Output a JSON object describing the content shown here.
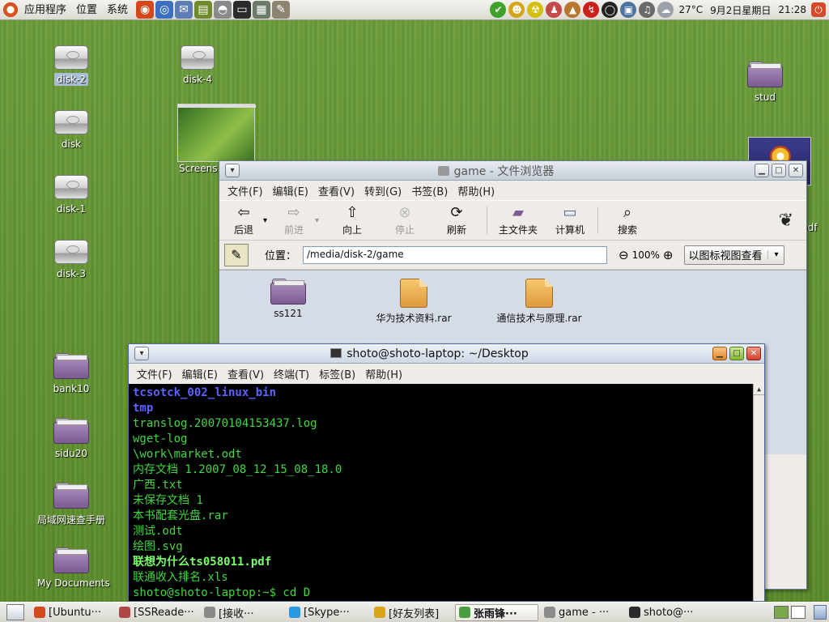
{
  "top_panel": {
    "menus": [
      "应用程序",
      "位置",
      "系统"
    ],
    "launchers": [
      {
        "icon": "firefox-icon",
        "color": "#d4481b",
        "glyph": "◉"
      },
      {
        "icon": "web-browser-icon",
        "color": "#3b6fc1",
        "glyph": "◎"
      },
      {
        "icon": "email-icon",
        "color": "#5e7db5",
        "glyph": "✉"
      },
      {
        "icon": "books-icon",
        "color": "#6f8a2a",
        "glyph": "▤"
      },
      {
        "icon": "disk-icon",
        "color": "#8a8a8a",
        "glyph": "◓"
      },
      {
        "icon": "terminal-icon",
        "color": "#2b2b2b",
        "glyph": "▭"
      },
      {
        "icon": "calculator-icon",
        "color": "#6c7a6a",
        "glyph": "▦"
      },
      {
        "icon": "text-editor-icon",
        "color": "#8d8572",
        "glyph": "✎"
      }
    ],
    "tray_icons": [
      {
        "icon": "update-check-icon",
        "color": "#3fa32b",
        "glyph": "✔"
      },
      {
        "icon": "user-icon",
        "color": "#d8a41c",
        "glyph": "☻"
      },
      {
        "icon": "radiation-icon",
        "color": "#d5bf0e",
        "glyph": "☢"
      },
      {
        "icon": "chat-icon",
        "color": "#c44a4a",
        "glyph": "♟"
      },
      {
        "icon": "tux-icon",
        "color": "#b8762e",
        "glyph": "▲"
      },
      {
        "icon": "flash-icon",
        "color": "#c9221c",
        "glyph": "↯"
      },
      {
        "icon": "eyes-icon",
        "color": "#222222",
        "glyph": "◯"
      },
      {
        "icon": "network-icon",
        "color": "#4d73a3",
        "glyph": "▣"
      },
      {
        "icon": "volume-icon",
        "color": "#6a6a6a",
        "glyph": "♫"
      },
      {
        "icon": "weather-icon",
        "color": "#9ca0a8",
        "glyph": "☁"
      }
    ],
    "temperature": "27°C",
    "date": "9月2日星期日",
    "time": "21:28",
    "shutdown_icon": "power-icon"
  },
  "desktop_icons": [
    {
      "label": "disk-2",
      "type": "drive",
      "selected": true
    },
    {
      "label": "disk-4",
      "type": "drive"
    },
    {
      "label": "disk",
      "type": "drive"
    },
    {
      "label": "disk-1",
      "type": "drive"
    },
    {
      "label": "disk-3",
      "type": "drive"
    },
    {
      "label": "bank10",
      "type": "folder"
    },
    {
      "label": "sidu20",
      "type": "folder"
    },
    {
      "label": "局域网速查手册",
      "type": "folder"
    },
    {
      "label": "My Documents",
      "type": "folder"
    },
    {
      "label": "stud",
      "type": "folder"
    },
    {
      "label": "Screens",
      "type": "thumbnail"
    },
    {
      "label": "pdf",
      "type": "thumbnail"
    }
  ],
  "file_browser": {
    "title": "game - 文件浏览器",
    "menus": [
      "文件(F)",
      "编辑(E)",
      "查看(V)",
      "转到(G)",
      "书签(B)",
      "帮助(H)"
    ],
    "toolbar": {
      "back": "后退",
      "forward": "前进",
      "up": "向上",
      "stop": "停止",
      "reload": "刷新",
      "home": "主文件夹",
      "computer": "计算机",
      "search": "搜索"
    },
    "location_label": "位置：",
    "location_value": "/media/disk-2/game",
    "zoom": "100%",
    "view_mode": "以图标视图查看",
    "files": [
      {
        "name": "ss121",
        "type": "folder"
      },
      {
        "name": "华为技术资料.rar",
        "type": "archive"
      },
      {
        "name": "通信技术与原理.rar",
        "type": "archive"
      }
    ]
  },
  "terminal": {
    "title": "shoto@shoto-laptop: ~/Desktop",
    "menus": [
      "文件(F)",
      "编辑(E)",
      "查看(V)",
      "终端(T)",
      "标签(B)",
      "帮助(H)"
    ],
    "lines": [
      {
        "text": "tcsotck_002_linux_bin",
        "style": "blue"
      },
      {
        "text": "tmp",
        "style": "blue"
      },
      {
        "text": "translog.20070104153437.log",
        "style": "normal"
      },
      {
        "text": "wget-log",
        "style": "normal"
      },
      {
        "text": "\\work\\market.odt",
        "style": "normal"
      },
      {
        "text": "内存文档 1.2007_08_12_15_08_18.0",
        "style": "normal"
      },
      {
        "text": "广西.txt",
        "style": "normal"
      },
      {
        "text": "未保存文档 1",
        "style": "normal"
      },
      {
        "text": "本书配套光盘.rar",
        "style": "normal"
      },
      {
        "text": "测试.odt",
        "style": "normal"
      },
      {
        "text": "绘图.svg",
        "style": "normal"
      },
      {
        "text": "联想为什么ts058011.pdf",
        "style": "bold"
      },
      {
        "text": "联通收入排名.xls",
        "style": "normal"
      },
      {
        "text": "shoto@shoto-laptop:~$ cd D",
        "style": "normal"
      }
    ]
  },
  "taskbar": {
    "tasks": [
      {
        "label": "[Ubuntu···",
        "icon": "firefox-icon",
        "color": "#d4481b",
        "active": false
      },
      {
        "label": "[SSReade···",
        "icon": "reader-icon",
        "color": "#b04646",
        "active": false
      },
      {
        "label": "[接收···",
        "icon": "mail-window-icon",
        "color": "#8a8a8a",
        "active": false
      },
      {
        "label": "[Skype···",
        "icon": "skype-icon",
        "color": "#2a9ae0",
        "active": false
      },
      {
        "label": "[好友列表]",
        "icon": "buddy-list-icon",
        "color": "#d8a41c",
        "active": false
      },
      {
        "label": "张雨锋···",
        "icon": "chat-window-icon",
        "color": "#4c9c40",
        "active": true
      },
      {
        "label": "game - ···",
        "icon": "folder-window-icon",
        "color": "#8c8c8c",
        "active": false
      },
      {
        "label": "shoto@···",
        "icon": "terminal-window-icon",
        "color": "#2b2b2b",
        "active": false
      }
    ]
  }
}
